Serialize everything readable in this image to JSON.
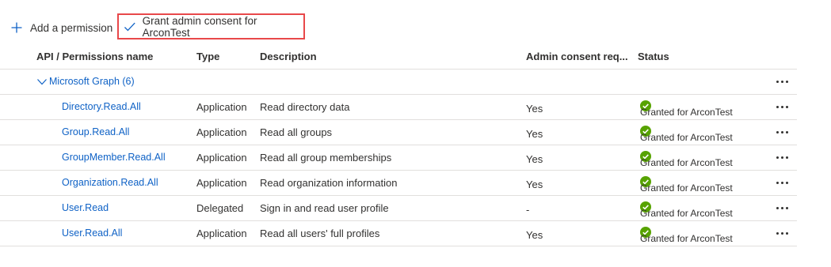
{
  "toolbar": {
    "add_label": "Add a permission",
    "grant_label": "Grant admin consent for ArconTest"
  },
  "table": {
    "headers": [
      "API / Permissions name",
      "Type",
      "Description",
      "Admin consent req...",
      "Status"
    ],
    "group": {
      "label": "Microsoft Graph (6)",
      "expanded": true
    },
    "rows": [
      {
        "name": "Directory.Read.All",
        "type": "Application",
        "description": "Read directory data",
        "admin_consent": "Yes",
        "status": "Granted for ArconTest"
      },
      {
        "name": "Group.Read.All",
        "type": "Application",
        "description": "Read all groups",
        "admin_consent": "Yes",
        "status": "Granted for ArconTest"
      },
      {
        "name": "GroupMember.Read.All",
        "type": "Application",
        "description": "Read all group memberships",
        "admin_consent": "Yes",
        "status": "Granted for ArconTest"
      },
      {
        "name": "Organization.Read.All",
        "type": "Application",
        "description": "Read organization information",
        "admin_consent": "Yes",
        "status": "Granted for ArconTest"
      },
      {
        "name": "User.Read",
        "type": "Delegated",
        "description": "Sign in and read user profile",
        "admin_consent": "-",
        "status": "Granted for ArconTest"
      },
      {
        "name": "User.Read.All",
        "type": "Application",
        "description": "Read all users' full profiles",
        "admin_consent": "Yes",
        "status": "Granted for ArconTest"
      }
    ]
  },
  "icons": {
    "add": "plus-icon",
    "grant": "checkmark-icon",
    "group": "chevron-down-icon",
    "status": "success-check-icon",
    "more": "more-horizontal-icon"
  },
  "colors": {
    "accent": "#0f62c6",
    "success": "#57a300",
    "highlight_border": "#e8484a"
  }
}
